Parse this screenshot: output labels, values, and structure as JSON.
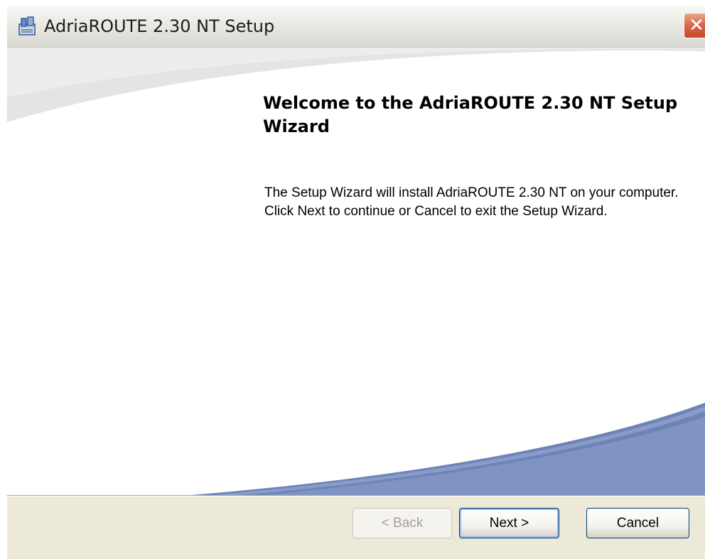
{
  "window": {
    "title": "AdriaROUTE 2.30 NT Setup"
  },
  "content": {
    "heading": "Welcome to the AdriaROUTE 2.30 NT Setup Wizard",
    "body": "The Setup Wizard will install AdriaROUTE 2.30 NT on your computer. Click Next to continue or Cancel to exit the Setup Wizard."
  },
  "buttons": {
    "back_label": "< Back",
    "next_label": "Next >",
    "cancel_label": "Cancel"
  },
  "icons": {
    "title_icon": "installer-icon",
    "close_icon": "close-icon"
  },
  "colors": {
    "accent_swoosh": "#7f94c3",
    "close_red": "#d86b4f"
  }
}
